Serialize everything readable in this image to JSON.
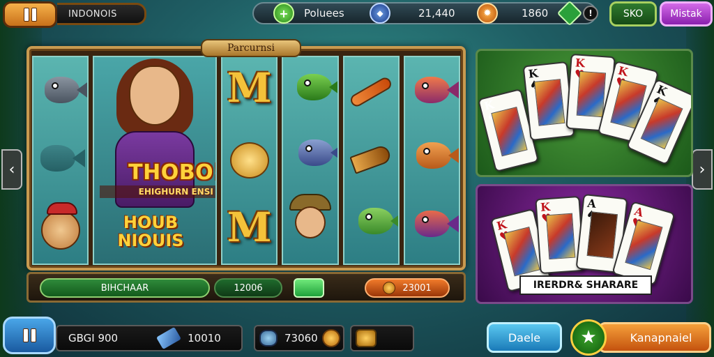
{
  "top_bar": {
    "game_name": "INDONOIS",
    "stats": [
      {
        "icon": "plus-coin-icon",
        "label": "Poluees"
      },
      {
        "icon": "gem-badge-icon",
        "label": "21,440"
      },
      {
        "icon": "fire-coin-icon",
        "label": "1860"
      },
      {
        "icon": "shield-icon",
        "label": ""
      }
    ],
    "btn_green": "SKO",
    "btn_purple": "Mistak"
  },
  "slot": {
    "banner": "Parcurnsi",
    "hero_title": "THOBO!",
    "hero_subtitle": "EHIGHURN ENSI",
    "bonus_title_line1": "HOUB",
    "bonus_title_line2": "NIOUIS",
    "bar": {
      "green_label": "BIHCHAAR",
      "dark_value": "12006",
      "toggle_label": "",
      "orange_value": "23001"
    }
  },
  "card_panels": {
    "top": {
      "cards": [
        {
          "rank": "K",
          "suit": "♠",
          "color": "black"
        },
        {
          "rank": "K",
          "suit": "♠",
          "color": "black"
        },
        {
          "rank": "K",
          "suit": "♥",
          "color": "red"
        },
        {
          "rank": "K",
          "suit": "♥",
          "color": "red"
        },
        {
          "rank": "K",
          "suit": "♠",
          "color": "black"
        }
      ]
    },
    "bottom": {
      "cards": [
        {
          "rank": "K",
          "suit": "♥",
          "color": "red"
        },
        {
          "rank": "K",
          "suit": "♥",
          "color": "red"
        },
        {
          "rank": "A",
          "suit": "♠",
          "color": "black"
        },
        {
          "rank": "A",
          "suit": "♥",
          "color": "red"
        }
      ],
      "title": "IRERDR& SHARARE"
    }
  },
  "bottom_bar": {
    "balance_label": "GBGI 900",
    "balance_value": "10010",
    "coins_value": "73060",
    "btn_blue": "Daele",
    "btn_orange": "Kanapnaiel"
  },
  "colors": {
    "accent_orange": "#f07a2a",
    "accent_green": "#2f8a3a",
    "accent_purple": "#8a1fae",
    "accent_blue": "#1a7ab8"
  }
}
